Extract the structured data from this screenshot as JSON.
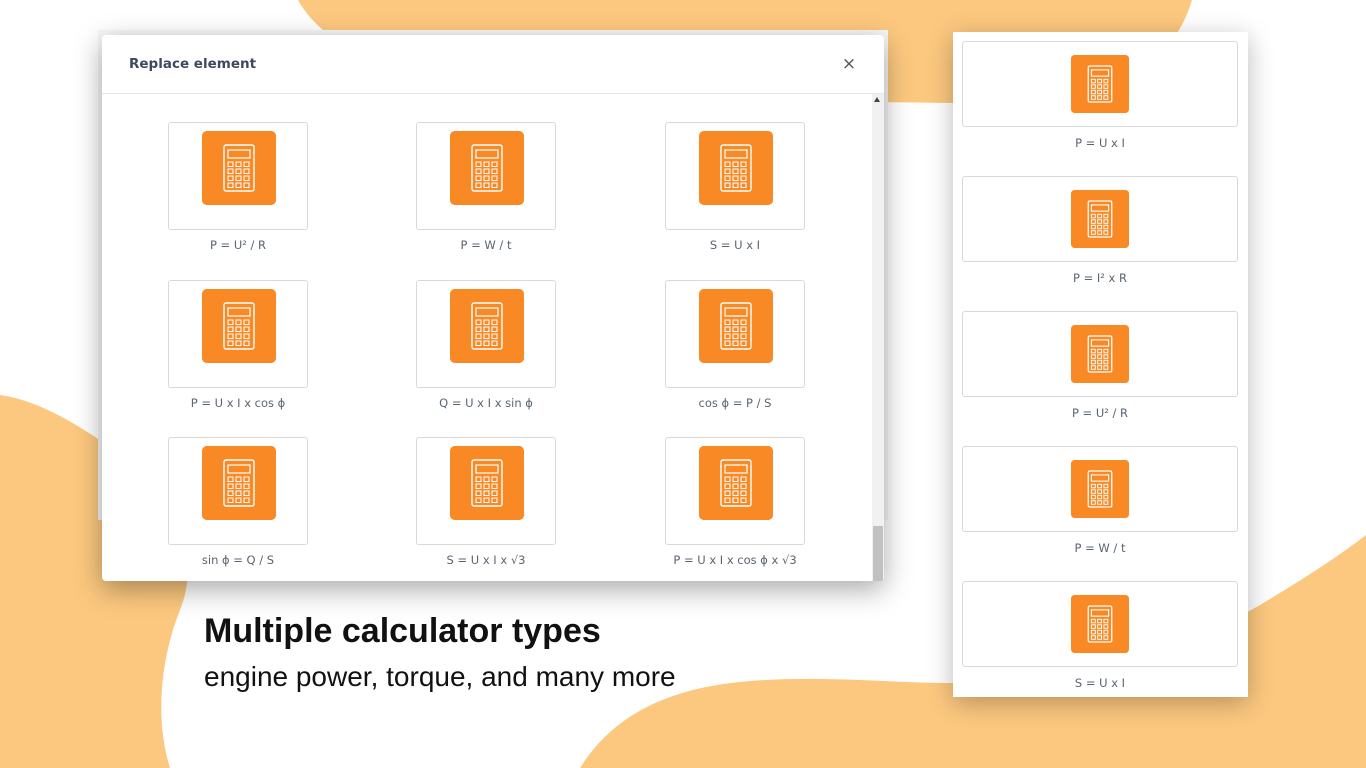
{
  "colors": {
    "blob": "#fcc87f",
    "icon_top": "#f99428",
    "icon_bottom": "#f46f21",
    "icon_glyph": "#ffffff"
  },
  "modal": {
    "title": "Replace element",
    "close_label": "×",
    "items": [
      {
        "label": "P = U² / R",
        "icon": "calculator-icon"
      },
      {
        "label": "P = W / t",
        "icon": "calculator-icon"
      },
      {
        "label": "S = U x I",
        "icon": "calculator-icon"
      },
      {
        "label": "P = U x I x cos ϕ",
        "icon": "calculator-icon"
      },
      {
        "label": "Q = U x I x sin ϕ",
        "icon": "calculator-icon"
      },
      {
        "label": "cos ϕ = P / S",
        "icon": "calculator-icon"
      },
      {
        "label": "sin ϕ = Q / S",
        "icon": "calculator-icon"
      },
      {
        "label": "S = U x I x √3",
        "icon": "calculator-icon"
      },
      {
        "label": "P = U x I x cos ϕ x √3",
        "icon": "calculator-icon"
      }
    ]
  },
  "side_panel": {
    "items": [
      {
        "label": "P = U x I",
        "icon": "calculator-icon"
      },
      {
        "label": "P = I² x R",
        "icon": "calculator-icon"
      },
      {
        "label": "P = U² / R",
        "icon": "calculator-icon"
      },
      {
        "label": "P = W / t",
        "icon": "calculator-icon"
      },
      {
        "label": "S = U x I",
        "icon": "calculator-icon"
      }
    ]
  },
  "caption": {
    "title": "Multiple calculator types",
    "subtitle": "engine power, torque, and many more"
  }
}
